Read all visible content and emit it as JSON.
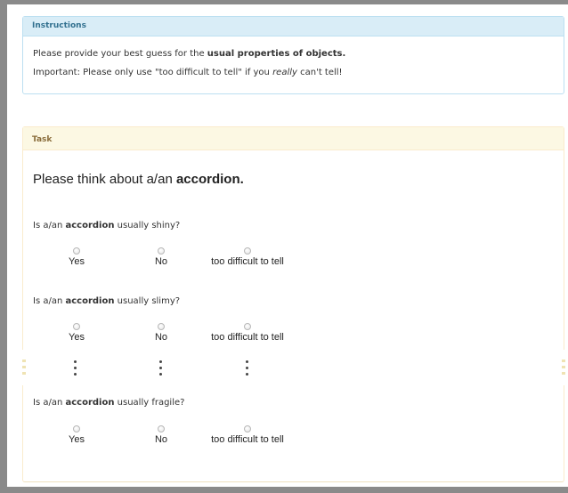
{
  "instructions": {
    "heading": "Instructions",
    "line1_pre": "Please provide your best guess for the ",
    "line1_bold": "usual properties of objects.",
    "line2_pre": "Important: Please only use \"too difficult to tell\" if you ",
    "line2_em": "really",
    "line2_post": " can't tell!"
  },
  "task": {
    "heading": "Task",
    "title_pre": "Please think about a/an ",
    "title_bold": "accordion.",
    "questions": [
      {
        "pre": "Is a/an ",
        "object": "accordion",
        "post": " usually shiny?"
      },
      {
        "pre": "Is a/an ",
        "object": "accordion",
        "post": " usually slimy?"
      },
      {
        "pre": "Is a/an ",
        "object": "accordion",
        "post": " usually fragile?"
      }
    ],
    "options": [
      "Yes",
      "No",
      "too difficult to tell"
    ]
  },
  "colors": {
    "info_heading_bg": "#d9edf7",
    "info_heading_text": "#31708f",
    "task_heading_bg": "#fcf8e3",
    "task_heading_text": "#8a6d3b"
  }
}
